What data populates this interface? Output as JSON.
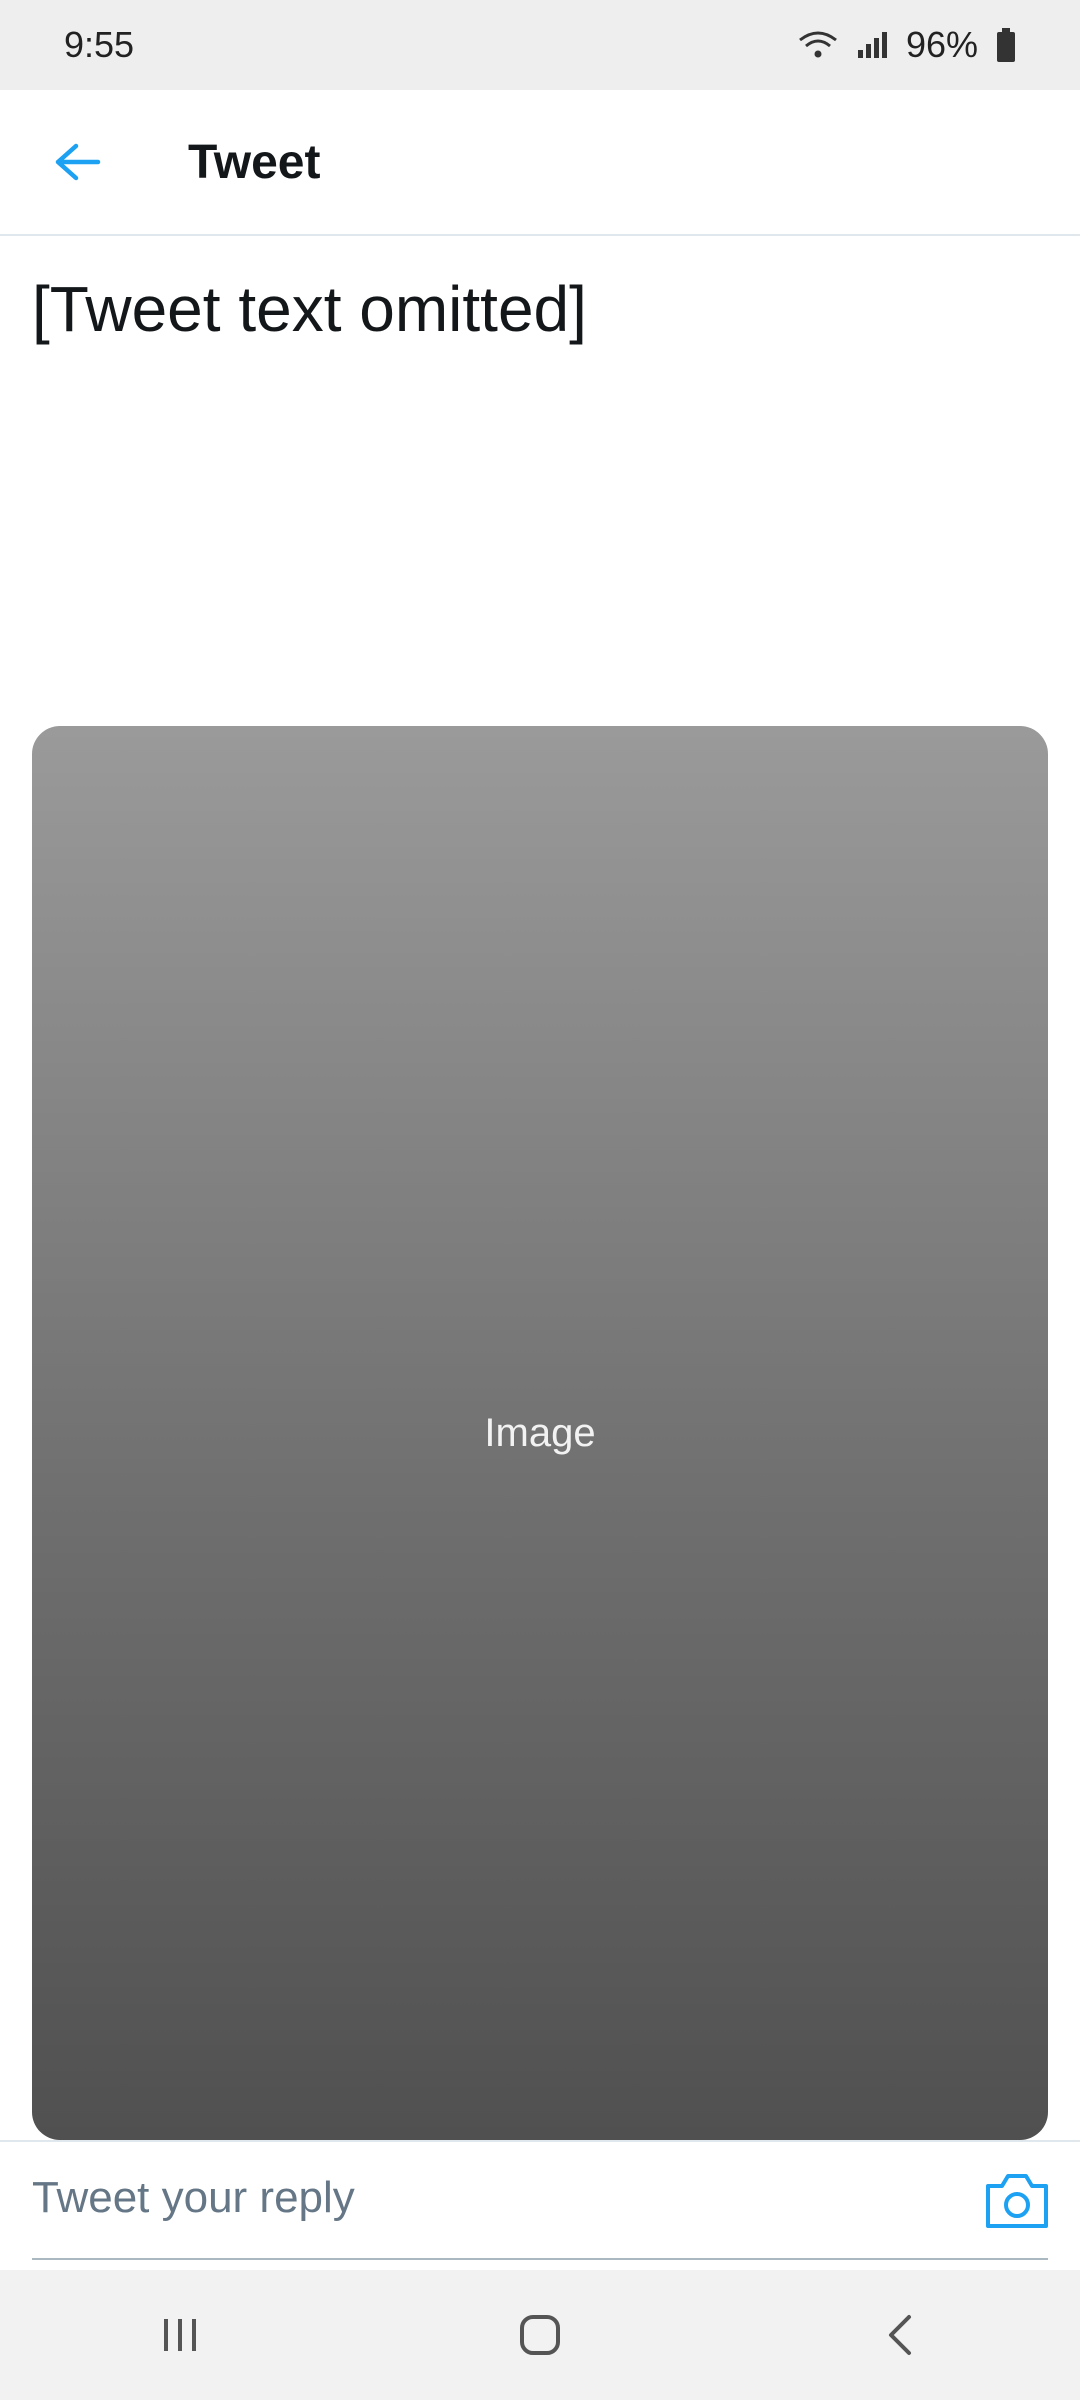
{
  "status_bar": {
    "time": "9:55",
    "battery": "96%"
  },
  "header": {
    "title": "Tweet",
    "back_icon": "arrow-left-icon"
  },
  "tweet": {
    "text": "[Tweet text omitted]"
  },
  "media": {
    "label": "Image"
  },
  "reply": {
    "placeholder": "Tweet your reply"
  },
  "colors": {
    "accent": "#1da1f2",
    "text": "#14171a",
    "muted": "#657786"
  }
}
